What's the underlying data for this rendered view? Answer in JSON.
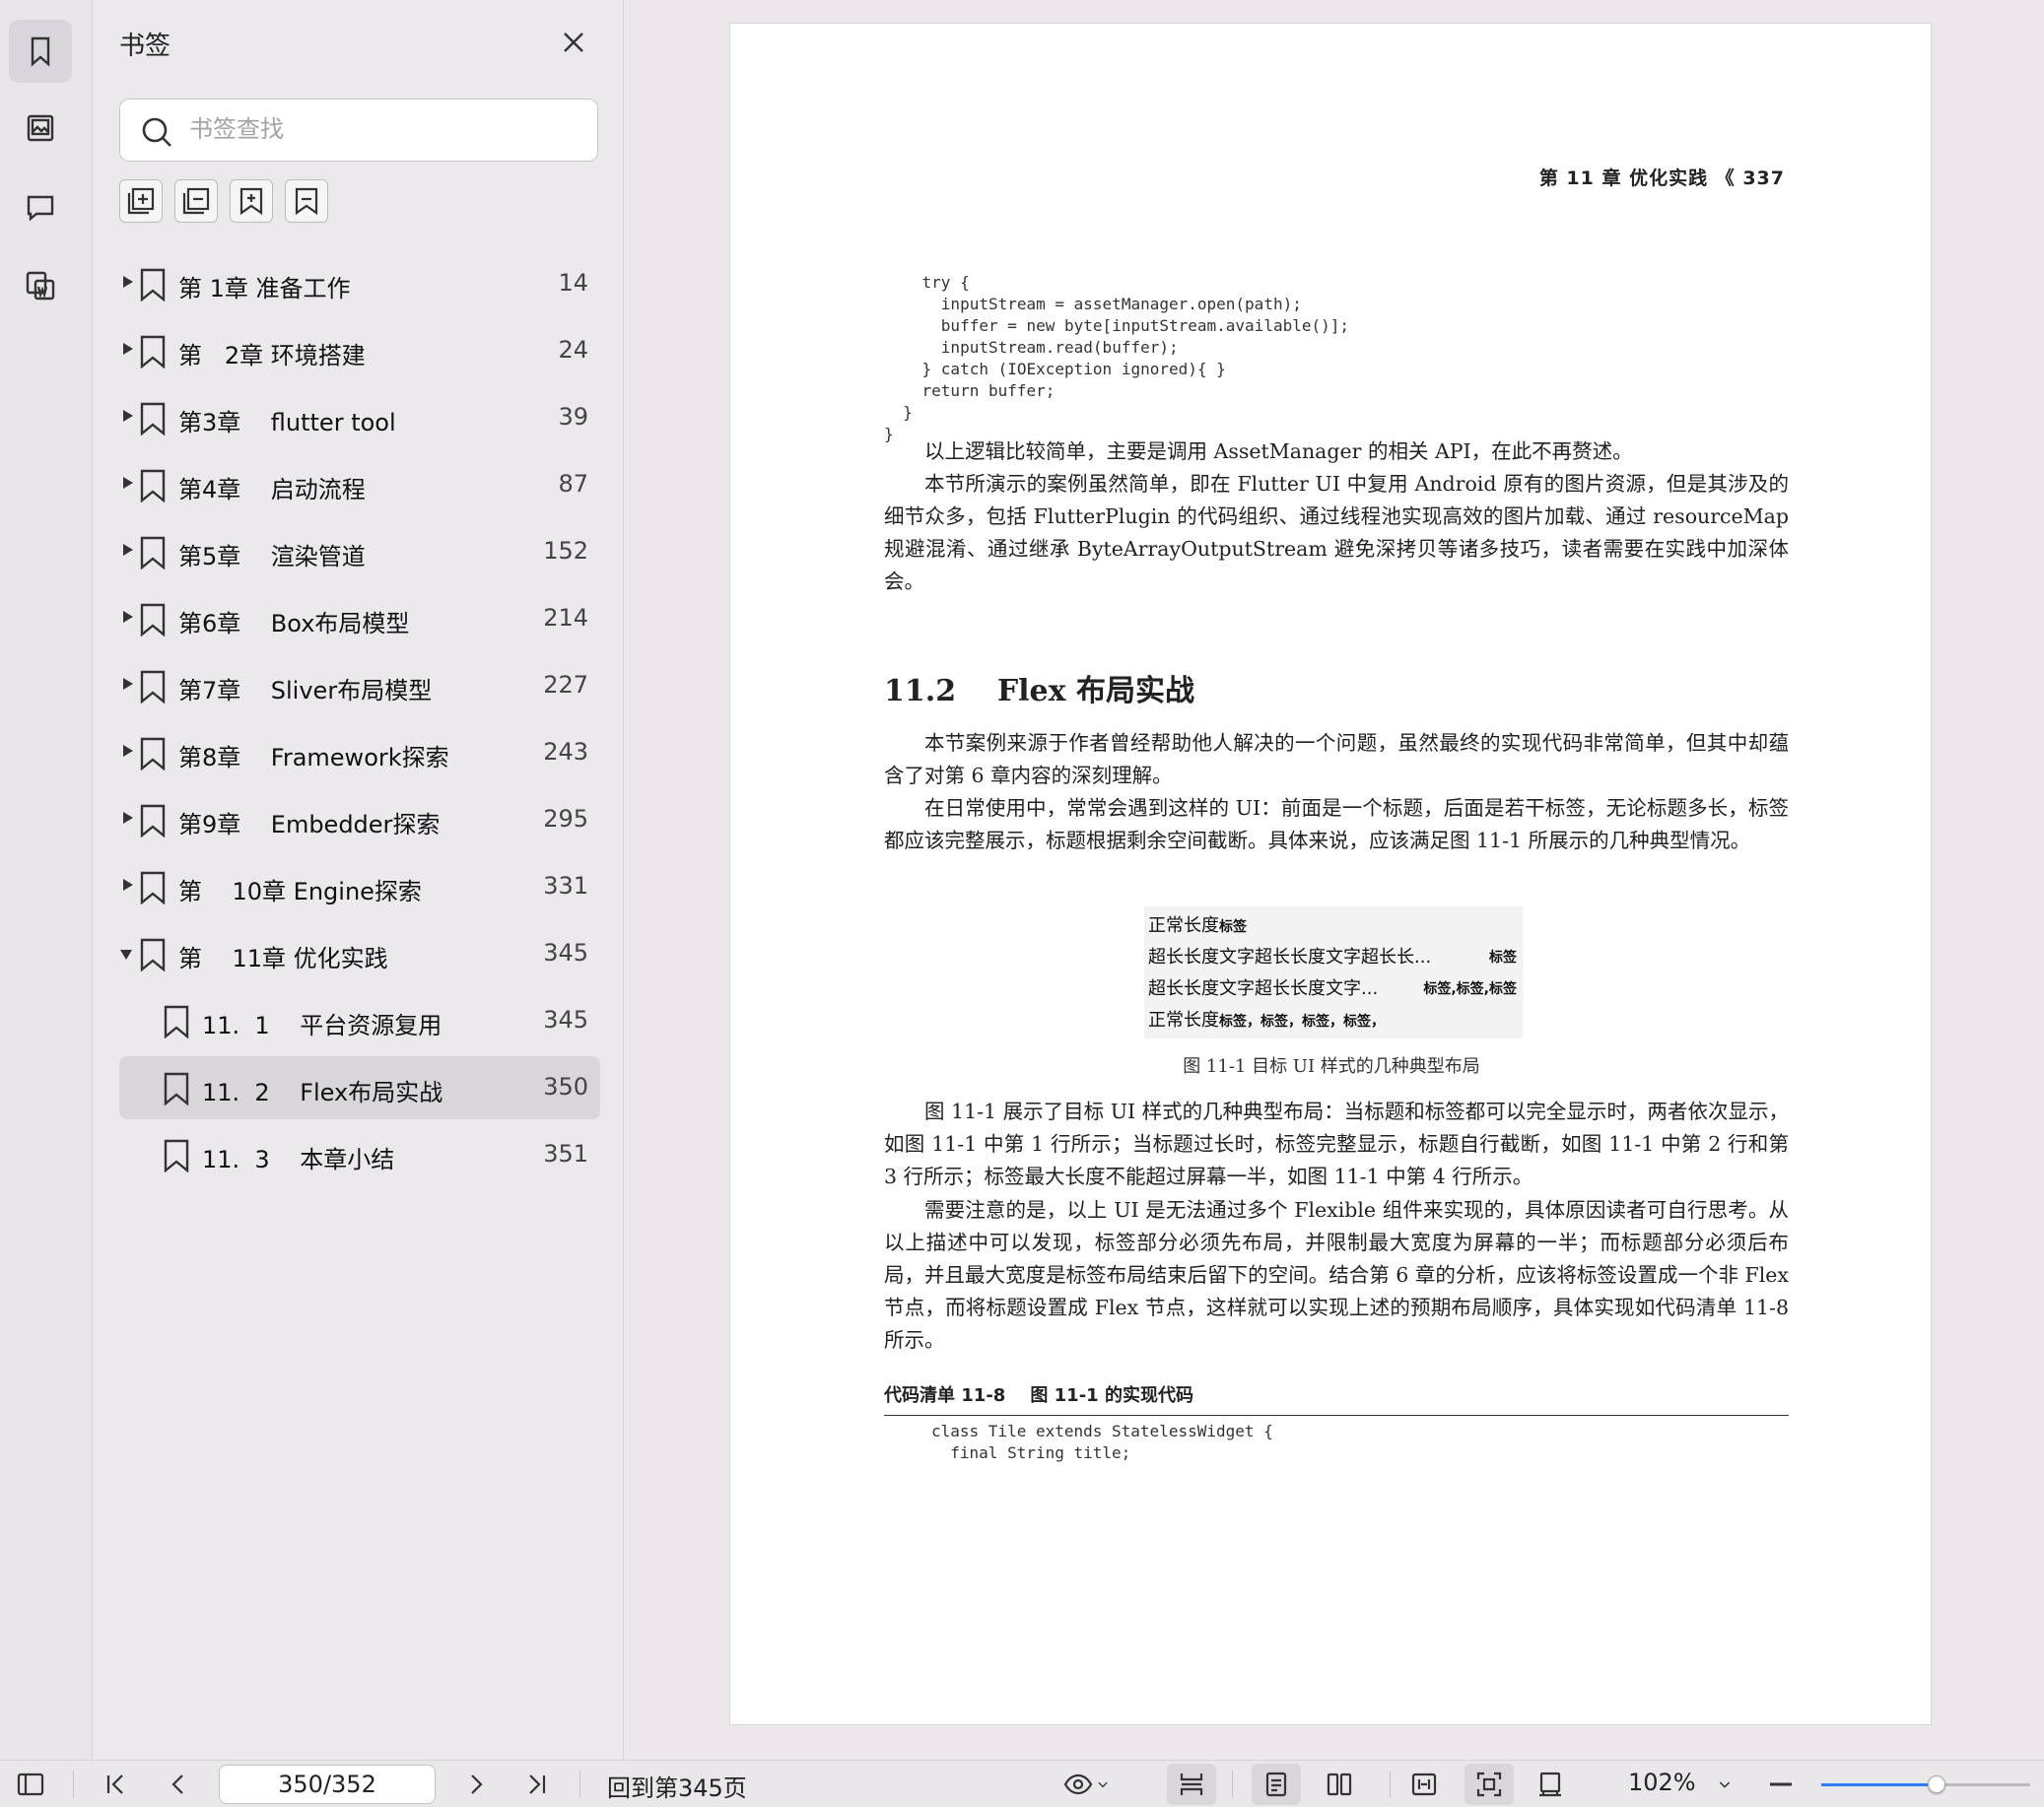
{
  "panel": {
    "title": "书签",
    "search_placeholder": "书签查找"
  },
  "bookmarks": [
    {
      "label": "第 1章 准备工作",
      "page": "14",
      "state": "collapsed",
      "level": 0
    },
    {
      "label": "第   2章 环境搭建",
      "page": "24",
      "state": "collapsed",
      "level": 0
    },
    {
      "label": "第3章    flutter tool",
      "page": "39",
      "state": "collapsed",
      "level": 0
    },
    {
      "label": "第4章    启动流程",
      "page": "87",
      "state": "collapsed",
      "level": 0
    },
    {
      "label": "第5章    渲染管道",
      "page": "152",
      "state": "collapsed",
      "level": 0
    },
    {
      "label": "第6章    Box布局模型",
      "page": "214",
      "state": "collapsed",
      "level": 0
    },
    {
      "label": "第7章    Sliver布局模型",
      "page": "227",
      "state": "collapsed",
      "level": 0
    },
    {
      "label": "第8章    Framework探索",
      "page": "243",
      "state": "collapsed",
      "level": 0
    },
    {
      "label": "第9章    Embedder探索",
      "page": "295",
      "state": "collapsed",
      "level": 0
    },
    {
      "label": "第    10章 Engine探索",
      "page": "331",
      "state": "collapsed",
      "level": 0
    },
    {
      "label": "第    11章 优化实践",
      "page": "345",
      "state": "expanded",
      "level": 0
    },
    {
      "label": "11.  1    平台资源复用",
      "page": "345",
      "state": "leaf",
      "level": 1
    },
    {
      "label": "11.  2    Flex布局实战",
      "page": "350",
      "state": "leaf",
      "level": 1,
      "selected": true
    },
    {
      "label": "11.  3    本章小结",
      "page": "351",
      "state": "leaf",
      "level": 1
    }
  ],
  "document": {
    "running_head": "第 11 章   优化实践   《   337",
    "code_top": "    try {\n      inputStream = assetManager.open(path);\n      buffer = new byte[inputStream.available()];\n      inputStream.read(buffer);\n    } catch (IOException ignored){ }\n    return buffer;\n  }\n}",
    "para1": "以上逻辑比较简单，主要是调用 AssetManager 的相关 API，在此不再赘述。",
    "para2": "本节所演示的案例虽然简单，即在 Flutter UI 中复用 Android 原有的图片资源，但是其涉及的细节众多，包括 FlutterPlugin 的代码组织、通过线程池实现高效的图片加载、通过 resourceMap 规避混淆、通过继承 ByteArrayOutputStream 避免深拷贝等诸多技巧，读者需要在实践中加深体会。",
    "section": "11.2    Flex 布局实战",
    "para3": "本节案例来源于作者曾经帮助他人解决的一个问题，虽然最终的实现代码非常简单，但其中却蕴含了对第 6 章内容的深刻理解。",
    "para4": "在日常使用中，常常会遇到这样的 UI：前面是一个标题，后面是若干标签，无论标题多长，标签都应该完整展示，标题根据剩余空间截断。具体来说，应该满足图 11-1 所展示的几种典型情况。",
    "figure_rows": [
      {
        "title": "正常长度",
        "tag": "标签",
        "tag_right": false
      },
      {
        "title": "超长长度文字超长长度文字超长长...",
        "tag": "标签",
        "tag_right": true
      },
      {
        "title": "超长长度文字超长长度文字...",
        "tag": "标签,标签,标签",
        "tag_right": true
      },
      {
        "title": "正常长度",
        "tag": "标签，标签，标签，标签，",
        "tag_right": false
      }
    ],
    "figure_caption": "图 11-1    目标 UI 样式的几种典型布局",
    "para5": "图 11-1 展示了目标 UI 样式的几种典型布局：当标题和标签都可以完全显示时，两者依次显示，如图 11-1 中第 1 行所示；当标题过长时，标签完整显示，标题自行截断，如图 11-1 中第 2 行和第 3 行所示；标签最大长度不能超过屏幕一半，如图 11-1 中第 4 行所示。",
    "para6": "需要注意的是，以上 UI 是无法通过多个 Flexible 组件来实现的，具体原因读者可自行思考。从以上描述中可以发现，标签部分必须先布局，并限制最大宽度为屏幕的一半；而标题部分必须后布局，并且最大宽度是标签布局结束后留下的空间。结合第 6 章的分析，应该将标签设置成一个非 Flex 节点，而将标题设置成 Flex 节点，这样就可以实现上述的预期布局顺序，具体实现如代码清单 11-8 所示。",
    "code_caption": "代码清单 11-8    图 11-1 的实现代码",
    "code_bottom": "class Tile extends StatelessWidget {\n  final String title;"
  },
  "toolbar": {
    "page_value": "350/352",
    "goto_label": "回到第345页",
    "zoom_label": "102%",
    "zoom_fraction": 0.55
  }
}
